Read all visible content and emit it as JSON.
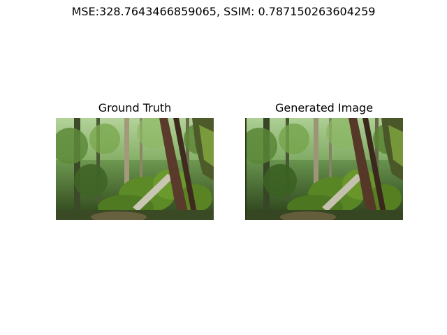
{
  "figure": {
    "suptitle": "MSE:328.7643466859065, SSIM: 0.787150263604259",
    "panels": [
      {
        "title": "Ground Truth"
      },
      {
        "title": "Generated Image"
      }
    ],
    "metrics": {
      "mse": 328.7643466859065,
      "ssim": 0.787150263604259
    },
    "image_content": "forest-scene"
  }
}
